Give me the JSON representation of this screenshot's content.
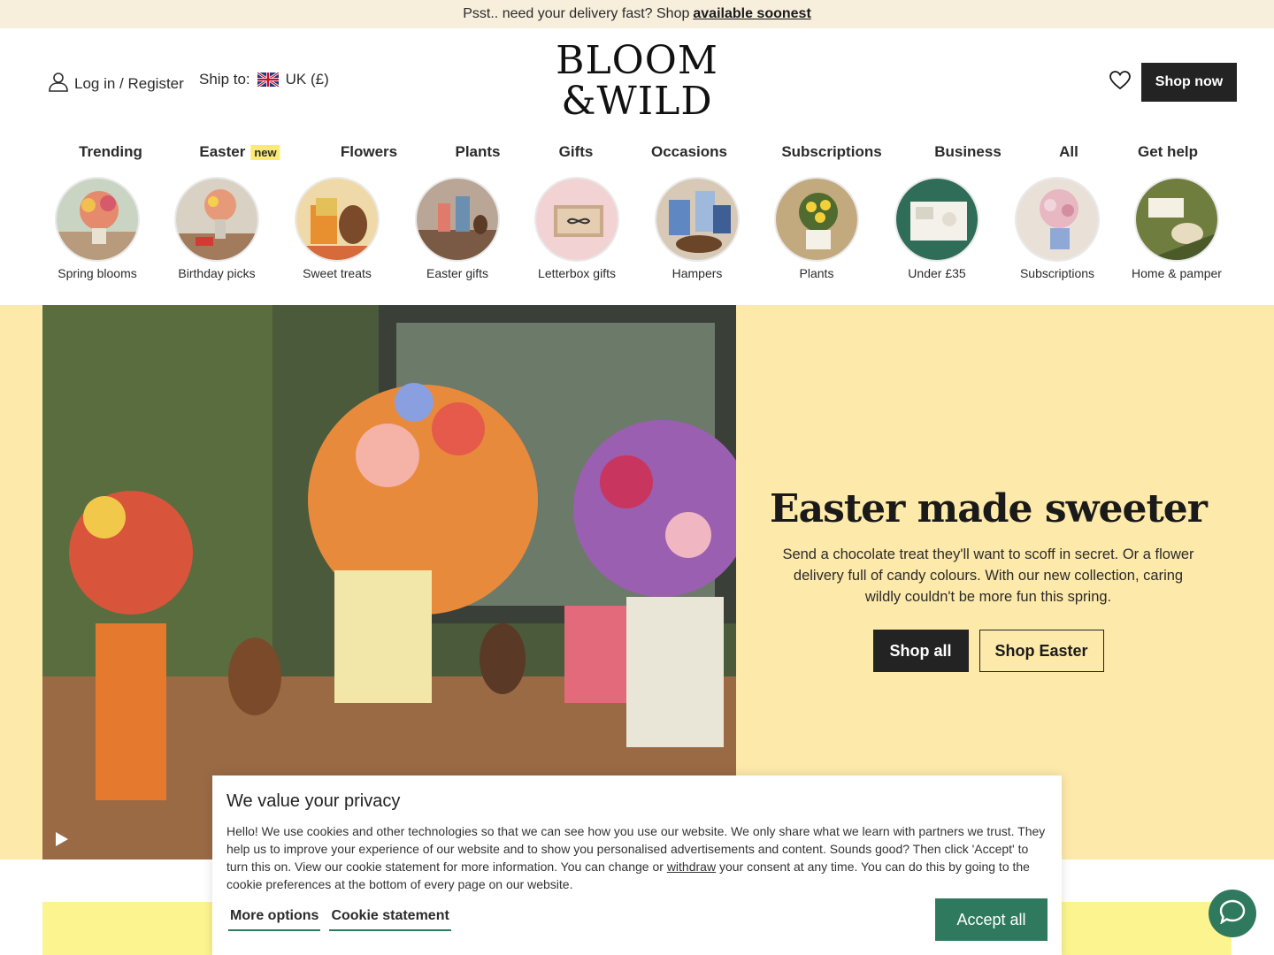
{
  "promo": {
    "text": "Psst.. need your delivery fast? Shop",
    "link": "available soonest"
  },
  "header": {
    "login_label": "Log in / Register",
    "ship_label": "Ship to:",
    "ship_country": "UK (£)",
    "logo_line1": "BLOOM",
    "logo_line2": "&WILD",
    "shop_now": "Shop now"
  },
  "nav": {
    "items": [
      {
        "label": "Trending"
      },
      {
        "label": "Easter",
        "badge": "new"
      },
      {
        "label": "Flowers"
      },
      {
        "label": "Plants"
      },
      {
        "label": "Gifts"
      },
      {
        "label": "Occasions"
      },
      {
        "label": "Subscriptions"
      },
      {
        "label": "Business"
      },
      {
        "label": "All"
      },
      {
        "label": "Get help"
      }
    ]
  },
  "categories": [
    {
      "label": "Spring blooms",
      "color": "#d98b6a"
    },
    {
      "label": "Birthday picks",
      "color": "#c96a56"
    },
    {
      "label": "Sweet treats",
      "color": "#e3a14a"
    },
    {
      "label": "Easter gifts",
      "color": "#a65e4b"
    },
    {
      "label": "Letterbox gifts",
      "color": "#f1cfcf"
    },
    {
      "label": "Hampers",
      "color": "#6d8fc0"
    },
    {
      "label": "Plants",
      "color": "#e0c44a"
    },
    {
      "label": "Under £35",
      "color": "#2f6d58"
    },
    {
      "label": "Subscriptions",
      "color": "#e7b7c2"
    },
    {
      "label": "Home & pamper",
      "color": "#6f7d3e"
    }
  ],
  "hero": {
    "title": "Easter made sweeter",
    "description": "Send a chocolate treat they'll want to scoff in secret. Or a flower delivery full of candy colours. With our new collection, caring wildly couldn't be more fun this spring.",
    "btn_primary": "Shop all",
    "btn_secondary": "Shop Easter"
  },
  "cookie": {
    "title": "We value your privacy",
    "text_before": "Hello! We use cookies and other technologies so that we can see how you use our website. We only share what we learn with partners we trust. They help us to improve your experience of our website and to show you personalised advertisements and content. Sounds good? Then click 'Accept' to turn this on. View our cookie statement for more information. You can change or ",
    "withdraw": "withdraw",
    "text_after": " your consent at any time. You can do this by going to the cookie preferences at the bottom of every page on our website.",
    "more_options": "More options",
    "cookie_statement": "Cookie statement",
    "accept_all": "Accept all"
  },
  "colors": {
    "accent_green": "#2f7a5e",
    "hero_bg": "#fde9a9",
    "promo_bg": "#f7eedc",
    "badge_yellow": "#fcea74"
  }
}
